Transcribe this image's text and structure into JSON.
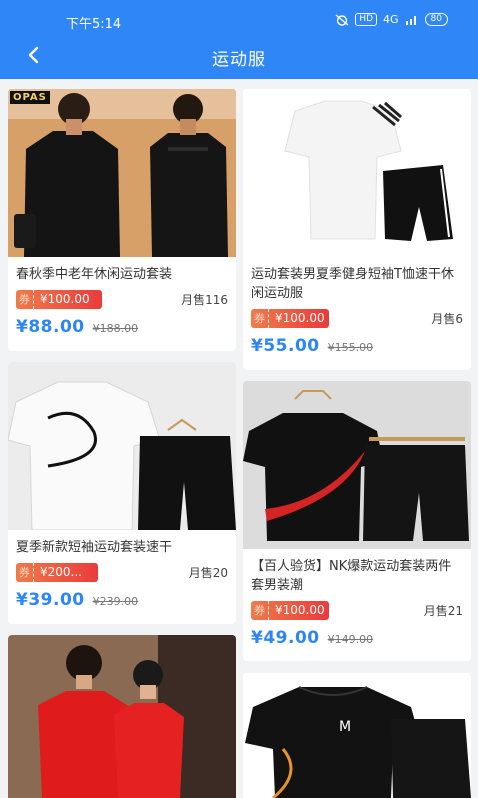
{
  "status_bar": {
    "time": "下午5:14",
    "hd": "HD",
    "signal": "4G",
    "battery": "80"
  },
  "header": {
    "title": "运动服"
  },
  "products": [
    {
      "name": "春秋季中老年休闲运动套装",
      "coupon_tag": "券",
      "coupon_value": "¥100.00",
      "sold": "月售116",
      "price": "¥88.00",
      "original_price": "¥188.00",
      "brand_badge": "OPAS"
    },
    {
      "name": "运动套装男夏季健身短袖T恤速干休闲运动服",
      "coupon_tag": "券",
      "coupon_value": "¥100.00",
      "sold": "月售6",
      "price": "¥55.00",
      "original_price": "¥155.00"
    },
    {
      "name": "夏季新款短袖运动套装速干",
      "coupon_tag": "券",
      "coupon_value": "¥200...",
      "sold": "月售20",
      "price": "¥39.00",
      "original_price": "¥239.00"
    },
    {
      "name": "【百人验货】NK爆款运动套装两件套男装潮",
      "coupon_tag": "券",
      "coupon_value": "¥100.00",
      "sold": "月售21",
      "price": "¥49.00",
      "original_price": "¥149.00"
    }
  ],
  "colors": {
    "header": "#2f86f6",
    "price": "#2d86f5",
    "coupon": "#ea3b3b"
  }
}
